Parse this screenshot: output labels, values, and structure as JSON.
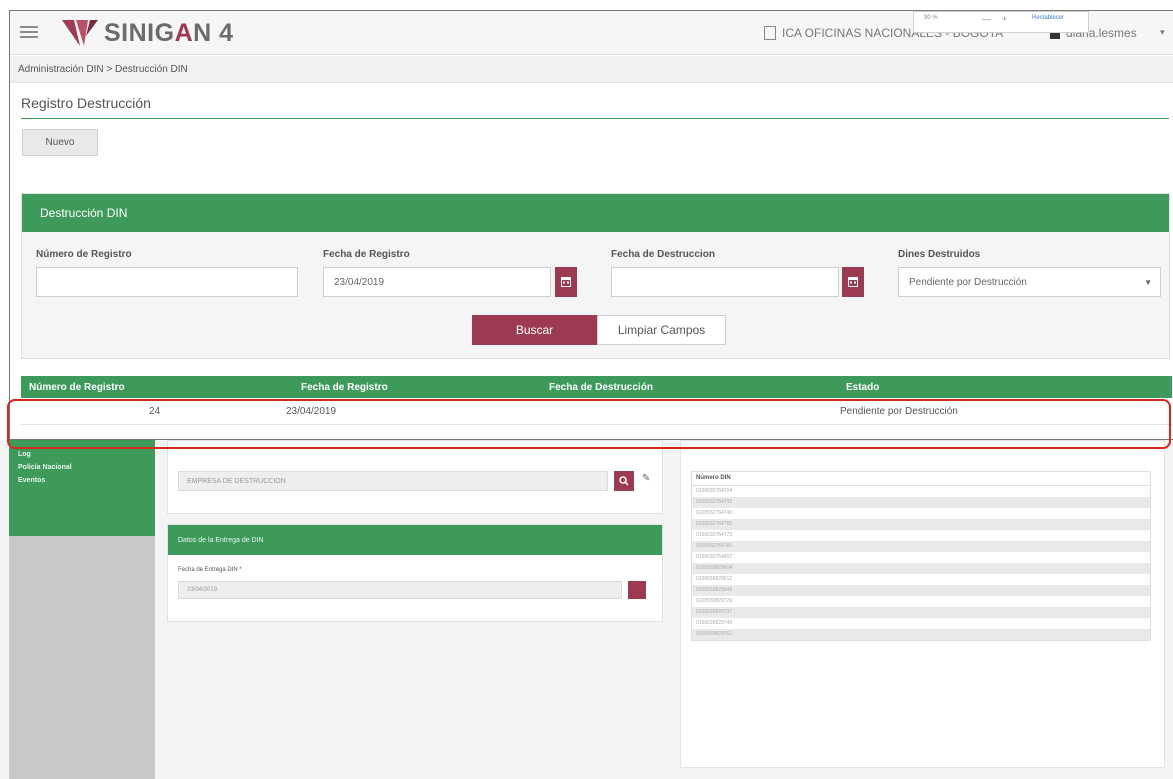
{
  "header": {
    "app_name_part1": "SINIG",
    "app_name_accent": "A",
    "app_name_part2": "N 4",
    "office": "ICA OFICINAS NACIONALES - BOGOTA",
    "user": "diana.lesmes",
    "zoom_popup": {
      "zoom": "90 %",
      "minus": "—",
      "plus": "+",
      "reset": "Restablecer"
    }
  },
  "breadcrumb": "Administración DIN > Destrucción DIN",
  "page_title": "Registro Destrucción",
  "nuevo_label": "Nuevo",
  "filter": {
    "header": "Destrucción DIN",
    "numero_label": "Número de Registro",
    "numero_value": "",
    "fecha_registro_label": "Fecha de Registro",
    "fecha_registro_value": "23/04/2019",
    "fecha_destruccion_label": "Fecha de Destruccion",
    "fecha_destruccion_value": "",
    "dines_label": "Dines Destruidos",
    "dines_value": "Pendiente por Destrucción",
    "buscar_label": "Buscar",
    "limpiar_label": "Limpiar Campos"
  },
  "results": {
    "columns": [
      "Número de Registro",
      "Fecha de Registro",
      "Fecha de Destrucción",
      "Estado"
    ],
    "rows": [
      {
        "numero": "24",
        "fecha_registro": "23/04/2019",
        "fecha_destruccion": "",
        "estado": "Pendiente por Destrucción"
      }
    ]
  },
  "background": {
    "sidebar_items": [
      "Log",
      "Policía Nacional",
      "Eventos"
    ],
    "empresa_placeholder": "EMPRESA DE DESTRUCCION",
    "entrega_header": "Datos de la Entrega de DIN",
    "entrega_label": "Fecha de Entrega DIN *",
    "entrega_value": "23/04/2019",
    "din_header": "Número DIN",
    "din_numbers": [
      "0100032764724",
      "0100032764732",
      "0100032764740",
      "0100032764765",
      "0100032764773",
      "0100032764781",
      "0100032764807",
      "0100039829604",
      "0100039829612",
      "0100039829646",
      "0100039829729",
      "0100039829737",
      "0100039829745",
      "0100039829752"
    ]
  },
  "colors": {
    "green": "#3e9a5a",
    "burgundy": "#9c3a52",
    "highlight": "#d9251c"
  }
}
